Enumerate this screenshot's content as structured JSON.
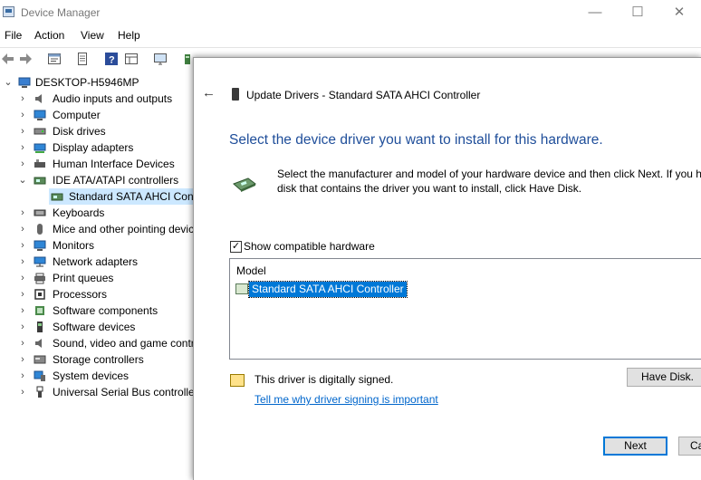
{
  "window": {
    "title": "Device Manager",
    "controls": {
      "minimize": "—",
      "maximize": "☐",
      "close": "✕"
    }
  },
  "menu": [
    "File",
    "Action",
    "View",
    "Help"
  ],
  "tree": {
    "root": "DESKTOP-H5946MP",
    "items": [
      {
        "label": "Audio inputs and outputs",
        "icon": "speaker-icon"
      },
      {
        "label": "Computer",
        "icon": "monitor-icon"
      },
      {
        "label": "Disk drives",
        "icon": "disk-drive-icon"
      },
      {
        "label": "Display adapters",
        "icon": "display-adapter-icon"
      },
      {
        "label": "Human Interface Devices",
        "icon": "hid-icon"
      },
      {
        "label": "IDE ATA/ATAPI controllers",
        "icon": "controller-icon"
      },
      {
        "label": "Standard SATA AHCI Cont",
        "icon": "sata-controller-icon"
      },
      {
        "label": "Keyboards",
        "icon": "keyboard-icon"
      },
      {
        "label": "Mice and other pointing devic",
        "icon": "mouse-icon"
      },
      {
        "label": "Monitors",
        "icon": "monitor-icon"
      },
      {
        "label": "Network adapters",
        "icon": "network-icon"
      },
      {
        "label": "Print queues",
        "icon": "printer-icon"
      },
      {
        "label": "Processors",
        "icon": "processor-icon"
      },
      {
        "label": "Software components",
        "icon": "software-component-icon"
      },
      {
        "label": "Software devices",
        "icon": "software-device-icon"
      },
      {
        "label": "Sound, video and game contr",
        "icon": "sound-icon"
      },
      {
        "label": "Storage controllers",
        "icon": "storage-icon"
      },
      {
        "label": "System devices",
        "icon": "system-icon"
      },
      {
        "label": "Universal Serial Bus controller",
        "icon": "usb-icon"
      }
    ]
  },
  "dialog": {
    "back_glyph": "←",
    "title": "Update Drivers - Standard SATA AHCI Controller",
    "heading": "Select the device driver you want to install for this hardware.",
    "desc_line1": "Select the manufacturer and model of your hardware device and then click Next. If you ha",
    "desc_line2": "disk that contains the driver you want to install, click Have Disk.",
    "show_compatible_label": "Show compatible hardware",
    "show_compatible_checked": "✓",
    "list_header": "Model",
    "list_item": "Standard SATA AHCI Controller",
    "signed_text": "This driver is digitally signed.",
    "signing_link": "Tell me why driver signing is important",
    "have_disk_label": "Have Disk.",
    "next_label": "Next",
    "cancel_label": "Ca"
  },
  "colors": {
    "heading": "#1f4e9a",
    "selection": "#0078d7",
    "tree_selection": "#cce8ff",
    "link": "#0066cc"
  }
}
